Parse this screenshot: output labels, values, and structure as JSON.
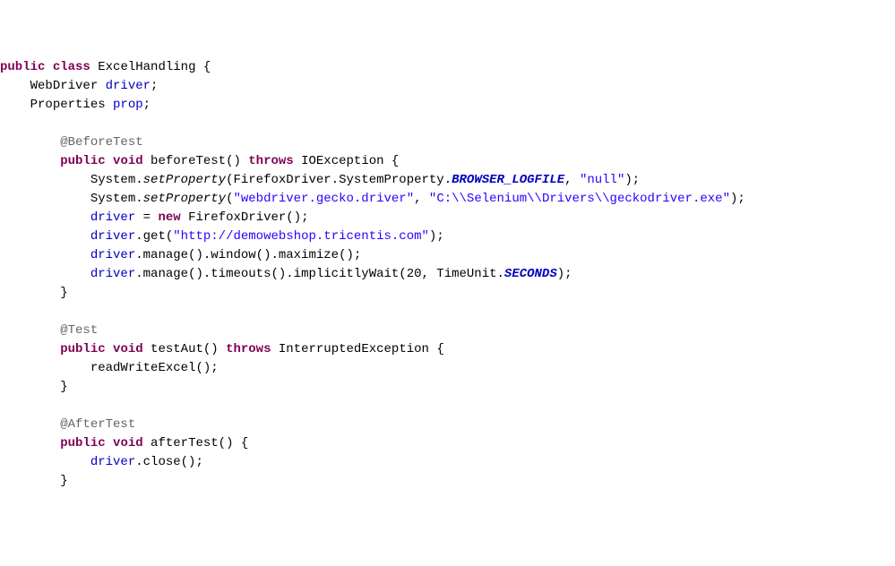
{
  "line1": {
    "kw1": "public",
    "kw2": "class",
    "name": "ExcelHandling",
    "brace": " {"
  },
  "line2": {
    "indent": "    ",
    "type": "WebDriver ",
    "field": "driver",
    "semi": ";"
  },
  "line3": {
    "indent": "    ",
    "type": "Properties ",
    "field": "prop",
    "semi": ";"
  },
  "line5": {
    "indent": "        ",
    "ann": "@BeforeTest"
  },
  "line6": {
    "indent": "        ",
    "kw1": "public",
    "kw2": "void",
    "name": " beforeTest() ",
    "kw3": "throws",
    "tail": " IOException {"
  },
  "line7": {
    "indent": "            ",
    "pre": "System.",
    "method": "setProperty",
    "mid1": "(FirefoxDriver.SystemProperty.",
    "konst": "BROWSER_LOGFILE",
    "mid2": ", ",
    "str": "\"null\"",
    "tail": ");"
  },
  "line8": {
    "indent": "            ",
    "pre": "System.",
    "method": "setProperty",
    "open": "(",
    "str1": "\"webdriver.gecko.driver\"",
    "mid": ", ",
    "str2": "\"C:\\\\Selenium\\\\Drivers\\\\geckodriver.exe\"",
    "tail": ");"
  },
  "line9": {
    "indent": "            ",
    "field": "driver",
    "eq": " = ",
    "kw": "new",
    "tail": " FirefoxDriver();"
  },
  "line10": {
    "indent": "            ",
    "field": "driver",
    "post": ".get(",
    "str": "\"http://demowebshop.tricentis.com\"",
    "tail": ");"
  },
  "line11": {
    "indent": "            ",
    "field": "driver",
    "tail": ".manage().window().maximize();"
  },
  "line12": {
    "indent": "            ",
    "field": "driver",
    "mid": ".manage().timeouts().implicitlyWait(20, TimeUnit.",
    "konst": "SECONDS",
    "tail": ");"
  },
  "line13": {
    "indent": "        ",
    "brace": "}"
  },
  "line15": {
    "indent": "        ",
    "ann": "@Test"
  },
  "line16": {
    "indent": "        ",
    "kw1": "public",
    "kw2": "void",
    "name": " testAut() ",
    "kw3": "throws",
    "tail": " InterruptedException {"
  },
  "line17": {
    "indent": "            ",
    "call": "readWriteExcel();"
  },
  "line18": {
    "indent": "        ",
    "brace": "}"
  },
  "line20": {
    "indent": "        ",
    "ann": "@AfterTest"
  },
  "line21": {
    "indent": "        ",
    "kw1": "public",
    "kw2": "void",
    "tail": " afterTest() {"
  },
  "line22": {
    "indent": "            ",
    "field": "driver",
    "tail": ".close();"
  },
  "line23": {
    "indent": "        ",
    "brace": "}"
  }
}
